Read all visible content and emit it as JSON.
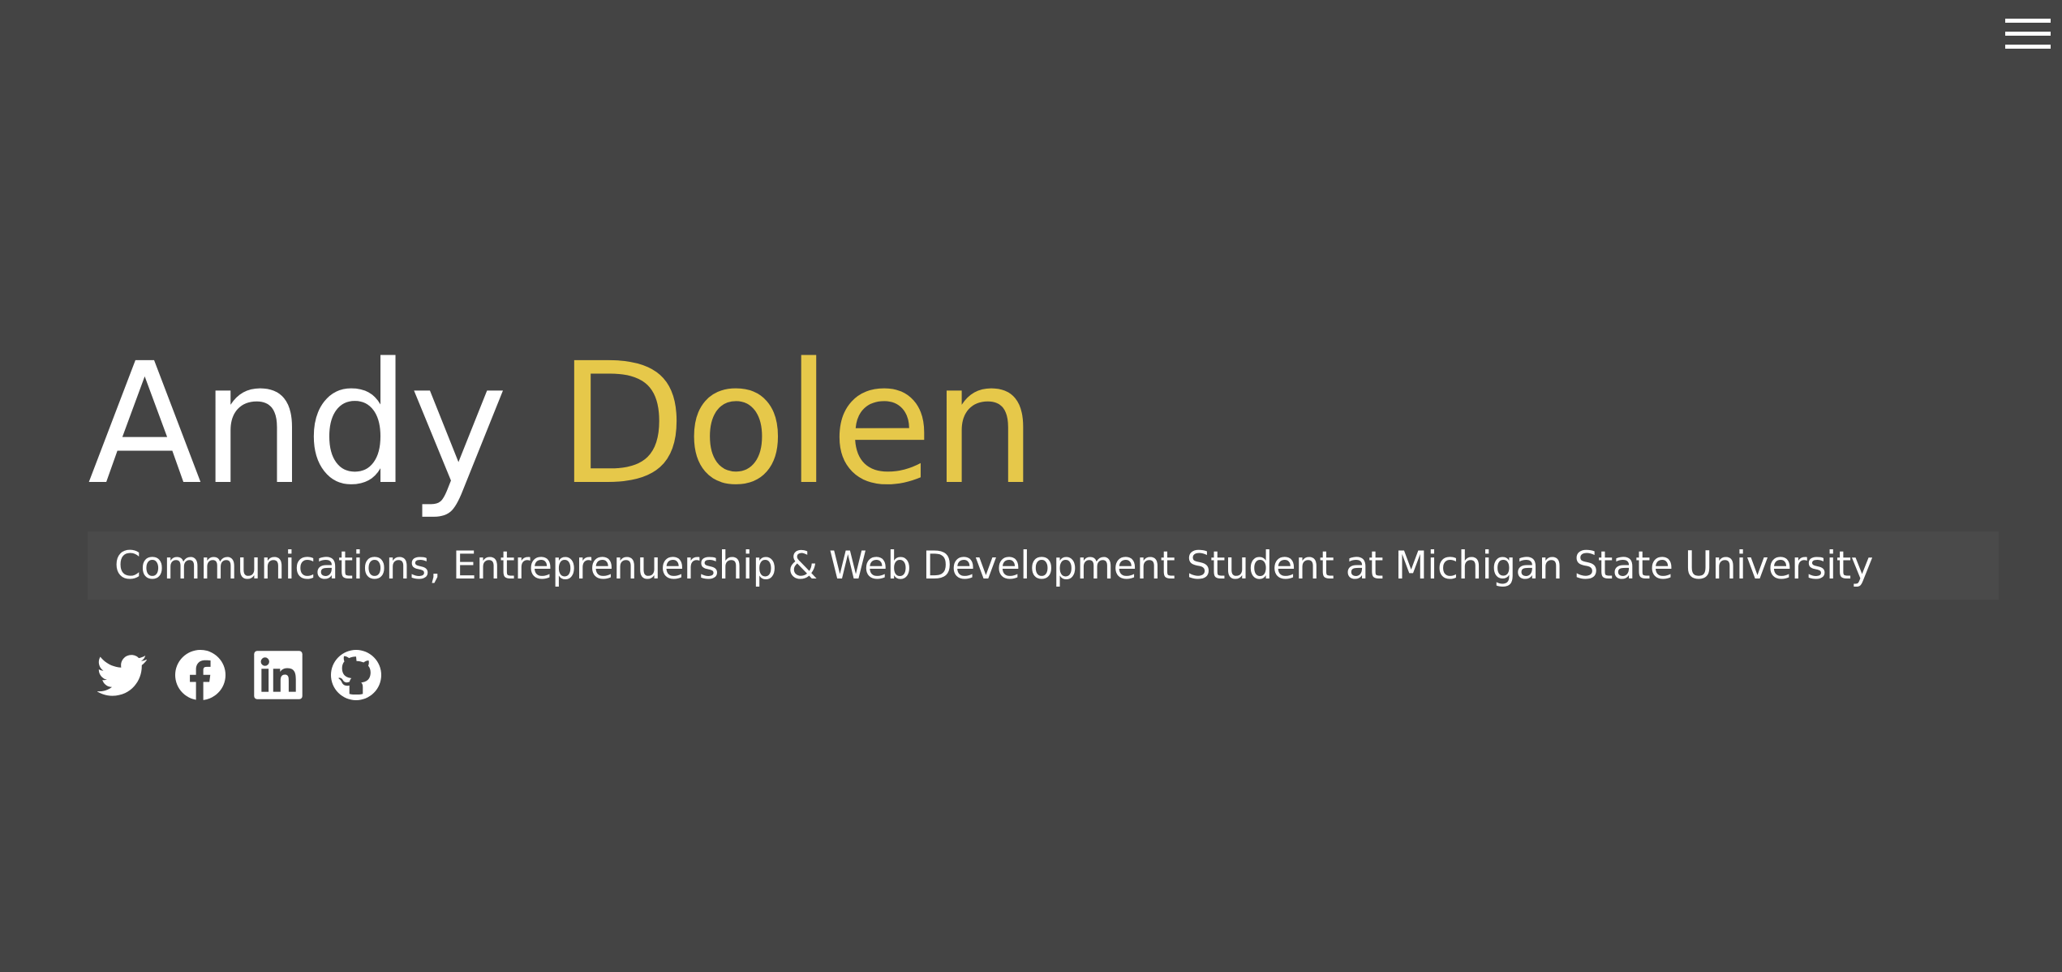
{
  "header": {
    "menu_icon": "hamburger-menu-icon"
  },
  "hero": {
    "first_name": "Andy",
    "last_name": "Dolen",
    "tagline": "Communications, Entreprenuership & Web Development Student at Michigan State University"
  },
  "social": [
    {
      "icon": "twitter-icon"
    },
    {
      "icon": "facebook-icon"
    },
    {
      "icon": "linkedin-icon"
    },
    {
      "icon": "github-icon"
    }
  ],
  "colors": {
    "background": "#444444",
    "accent": "#e6c84a",
    "text": "#ffffff",
    "tagline_background": "#4a4a4a"
  }
}
